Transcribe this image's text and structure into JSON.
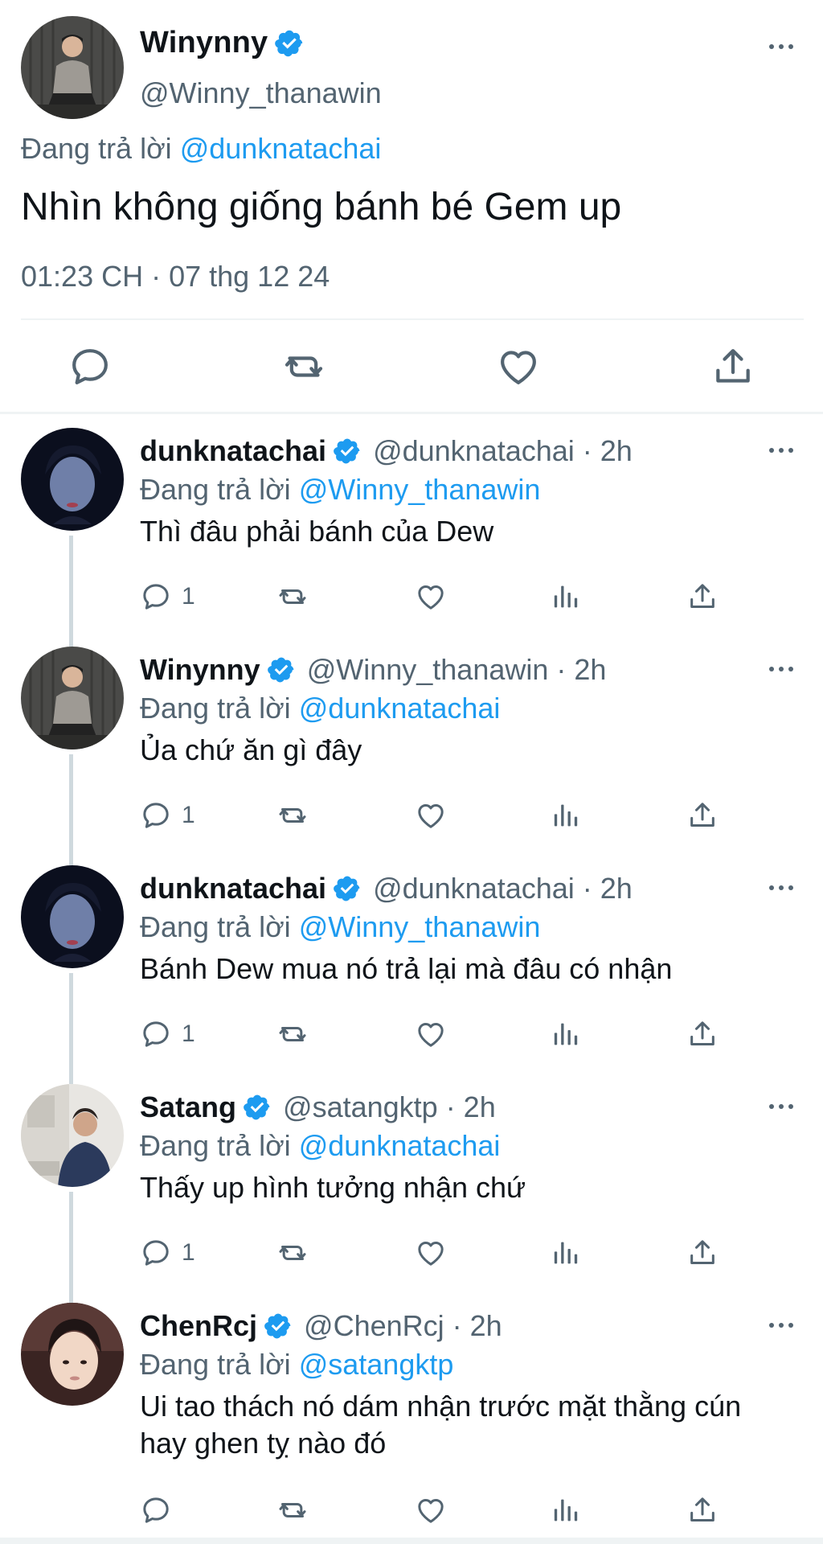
{
  "main_tweet": {
    "display_name": "Winynny",
    "handle": "@Winny_thanawin",
    "replying_prefix": "Đang trả lời",
    "replying_to": "@dunknatachai",
    "text": "Nhìn không giống bánh bé Gem up",
    "timestamp": "01:23 CH · 07 thg 12 24",
    "icons": [
      "reply-icon",
      "retweet-icon",
      "like-icon",
      "share-icon"
    ]
  },
  "replies": [
    {
      "display_name": "dunknatachai",
      "handle_time": "@dunknatachai · 2h",
      "replying_prefix": "Đang trả lời",
      "replying_to": "@Winny_thanawin",
      "text": "Thì đâu phải bánh của Dew",
      "reply_count": "1"
    },
    {
      "display_name": "Winynny",
      "handle_time": "@Winny_thanawin · 2h",
      "replying_prefix": "Đang trả lời",
      "replying_to": "@dunknatachai",
      "text": "Ủa chứ ăn gì đây",
      "reply_count": "1"
    },
    {
      "display_name": "dunknatachai",
      "handle_time": "@dunknatachai · 2h",
      "replying_prefix": "Đang trả lời",
      "replying_to": "@Winny_thanawin",
      "text": "Bánh Dew mua nó trả lại mà đâu có nhận",
      "reply_count": "1"
    },
    {
      "display_name": "Satang",
      "handle_time": "@satangktp · 2h",
      "replying_prefix": "Đang trả lời",
      "replying_to": "@dunknatachai",
      "text": "Thấy up hình tưởng nhận chứ",
      "reply_count": "1"
    },
    {
      "display_name": "ChenRcj",
      "handle_time": "@ChenRcj · 2h",
      "replying_prefix": "Đang trả lời",
      "replying_to": "@satangktp",
      "text": "Ui tao thách nó dám nhận trước mặt thằng cún hay ghen tỵ nào đó",
      "reply_count": ""
    }
  ],
  "colors": {
    "link": "#1d9bf0",
    "secondary_text": "#536471",
    "primary_text": "#0f1419",
    "divider": "#eff3f4",
    "thread_line": "#cfd9de",
    "verified": "#1d9bf0"
  }
}
